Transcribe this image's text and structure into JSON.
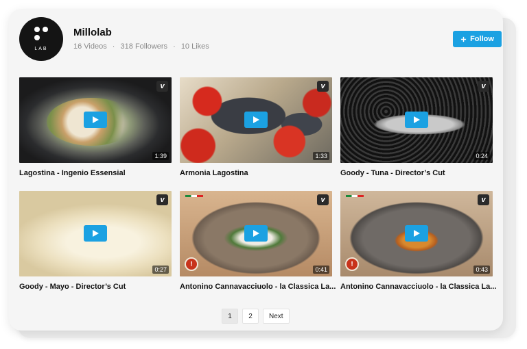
{
  "channel": {
    "name": "Millolab",
    "logo_text": "LAB",
    "videos_count": "16 Videos",
    "followers": "318 Followers",
    "likes": "10 Likes",
    "separator": "·",
    "follow_label": "Follow",
    "follow_icon": "plus-icon"
  },
  "videos": [
    {
      "title": "Lagostina - Ingenio Essensial",
      "duration": "1:39"
    },
    {
      "title": "Armonia Lagostina",
      "duration": "1:33"
    },
    {
      "title": "Goody - Tuna - Director’s Cut",
      "duration": "0:24"
    },
    {
      "title": "Goody - Mayo - Director’s Cut",
      "duration": "0:27"
    },
    {
      "title": "Antonino Cannavacciuolo - la Classica La...",
      "duration": "0:41"
    },
    {
      "title": "Antonino Cannavacciuolo - la Classica La...",
      "duration": "0:43"
    }
  ],
  "vimeo_badge": "v",
  "pagination": {
    "pages": [
      "1",
      "2"
    ],
    "next_label": "Next",
    "current": "1"
  },
  "colors": {
    "accent": "#1ba1e2",
    "card_bg": "#f5f5f5",
    "text": "#111111",
    "muted": "#8a8a8a"
  }
}
